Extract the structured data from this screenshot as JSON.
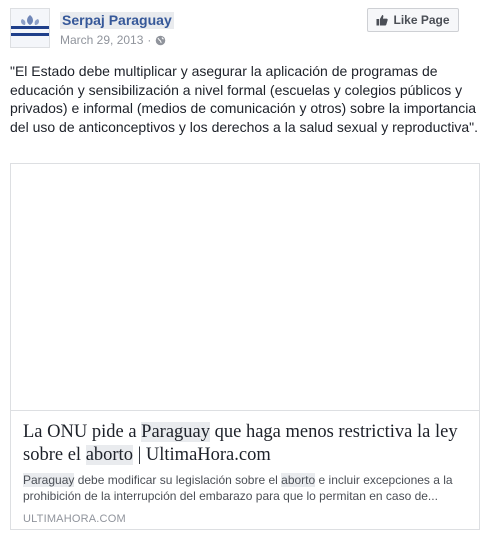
{
  "post": {
    "page_name": "Serpaj Paraguay",
    "date": "March 29, 2013",
    "separator": "·",
    "audience_icon": "globe-icon",
    "like_button_label": "Like Page",
    "like_icon": "thumbs-up-icon",
    "text": "\"El Estado debe multiplicar y asegurar la aplicación de programas de educación y sensibilización a nivel formal (escuelas y colegios públicos y privados) e informal (medios de comunicación y otros) sobre la importancia del uso de anticonceptivos y los derechos a la salud sexual y reproductiva\"."
  },
  "link_card": {
    "title_parts": [
      "La ONU pide a ",
      "Paraguay",
      " que haga menos restrictiva la ley sobre el ",
      "aborto",
      " | UltimaHora.com"
    ],
    "description_parts": [
      "Paraguay",
      " debe modificar su legislación sobre el ",
      "aborto",
      " e incluir excepciones a la prohibición de la interrupción del embarazo para que lo permitan en caso de..."
    ],
    "domain": "ULTIMAHORA.COM"
  },
  "colors": {
    "link_blue": "#365899",
    "highlight": "#e9ebee",
    "muted": "#90949c"
  }
}
